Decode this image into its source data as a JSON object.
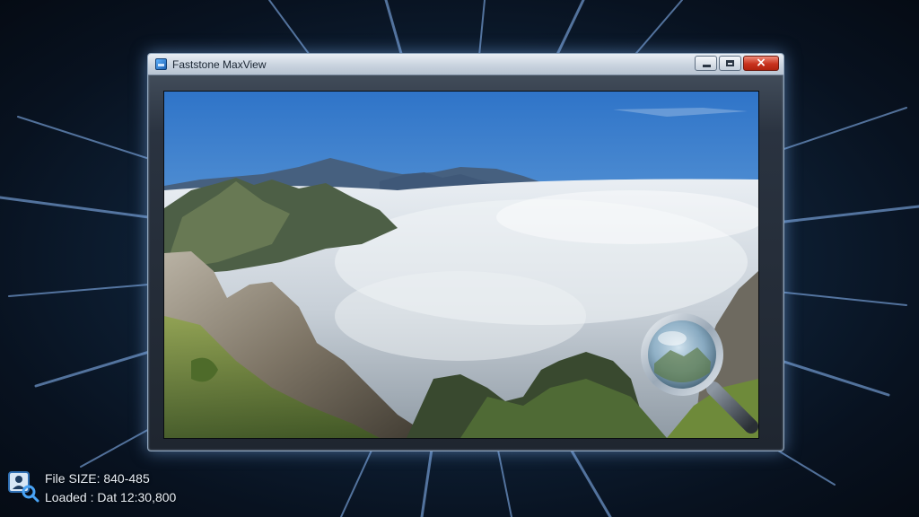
{
  "window": {
    "title": "Faststone MaxView",
    "buttons": {
      "minimize": "minimize",
      "maximize": "maximize",
      "close": "×"
    }
  },
  "viewer": {
    "image_subject": "mountain-peaks-above-sea-of-clouds"
  },
  "overlay": {
    "zoom_icon": "magnifier-icon"
  },
  "status": {
    "file_size_line": "File SIZE: 840-485",
    "loaded_line": "Loaded : Dat 12:30,800"
  },
  "colors": {
    "accent_glow": "#78aae6",
    "close_button": "#c8321e",
    "background": "#0b1524"
  }
}
